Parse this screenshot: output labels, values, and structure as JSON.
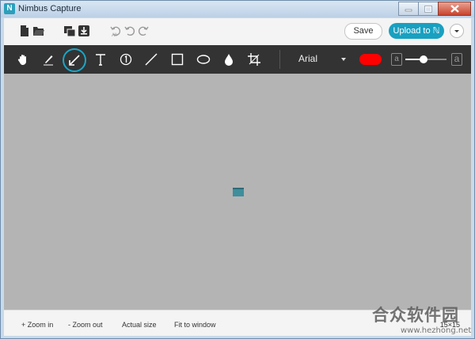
{
  "window": {
    "title": "Nimbus Capture",
    "app_icon_letter": "N"
  },
  "toolbar_top": {
    "save_label": "Save",
    "upload_label": "Upload to ℕ",
    "icons": [
      "new-file-icon",
      "open-folder-icon",
      "copy-icon",
      "download-icon",
      "undo-all-icon",
      "undo-icon",
      "redo-icon"
    ]
  },
  "toolbar_draw": {
    "tools": [
      "hand",
      "pen",
      "arrow",
      "text",
      "numbered",
      "line",
      "rectangle",
      "ellipse",
      "blur",
      "crop"
    ],
    "active_tool": "arrow",
    "font": "Arial",
    "color": "#ff0000",
    "size_small_label": "a",
    "size_large_label": "a",
    "size_value": 0.45
  },
  "status": {
    "zoom_in": "+ Zoom in",
    "zoom_out": "- Zoom out",
    "actual_size": "Actual size",
    "fit_to_window": "Fit to window",
    "dimensions": "15×15"
  },
  "watermark": {
    "title": "合众软件园",
    "url": "www.hezhong.net"
  }
}
